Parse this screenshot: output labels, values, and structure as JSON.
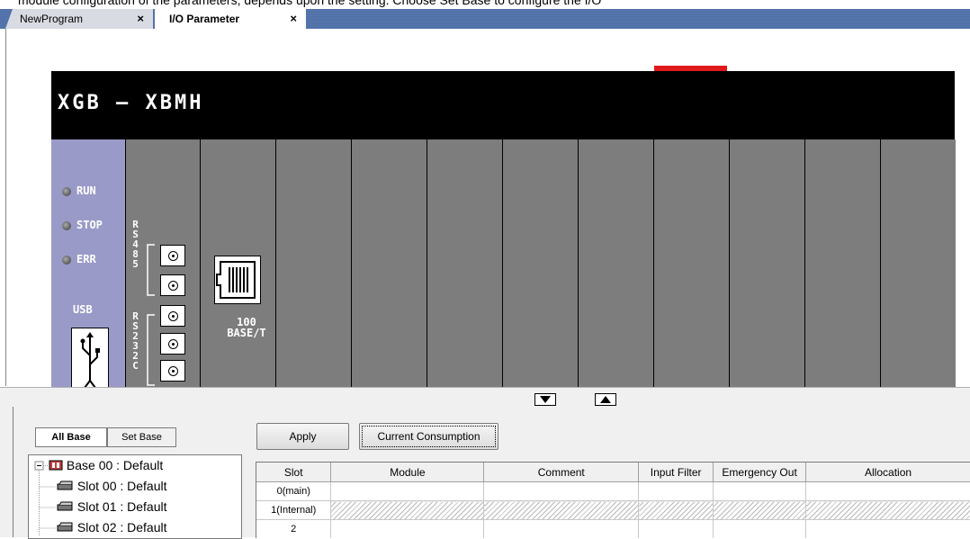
{
  "top_strip_text": "module configuration of the parameters, depends upon the setting. Choose Set Base to configure the I/O",
  "tabs": [
    {
      "label": "NewProgram",
      "close": "×"
    },
    {
      "label": "I/O Parameter",
      "close": "×"
    }
  ],
  "plc": {
    "model": "XGB — XBMH",
    "leds": [
      "RUN",
      "STOP",
      "ERR"
    ],
    "usb_label": "USB",
    "rs485_label": "RS485",
    "rs232_label": "RS232C",
    "eth_label_line1": "100",
    "eth_label_line2": "BASE/T",
    "colors": {
      "body": "#000000",
      "cpu_panel": "#9a9ac9",
      "slot": "#7d7d7d",
      "indicator": "#e0191c"
    }
  },
  "splitter": {
    "down_icon": "triangle-down-icon",
    "up_icon": "triangle-up-icon"
  },
  "base_tabs": [
    "All Base",
    "Set Base"
  ],
  "tree": [
    {
      "label": "Base 00 : Default",
      "icon": "base-icon"
    },
    {
      "label": "Slot 00 : Default",
      "icon": "slot-icon"
    },
    {
      "label": "Slot 01 : Default",
      "icon": "slot-icon"
    },
    {
      "label": "Slot 02 : Default",
      "icon": "slot-icon"
    }
  ],
  "buttons": {
    "apply": "Apply",
    "consumption": "Current Consumption"
  },
  "grid": {
    "columns": [
      "Slot",
      "Module",
      "Comment",
      "Input Filter",
      "Emergency Out",
      "Allocation"
    ],
    "rows": [
      {
        "slot": "0(main)",
        "hatched": false
      },
      {
        "slot": "1(Internal)",
        "hatched": true
      },
      {
        "slot": "2",
        "hatched": false
      }
    ]
  }
}
